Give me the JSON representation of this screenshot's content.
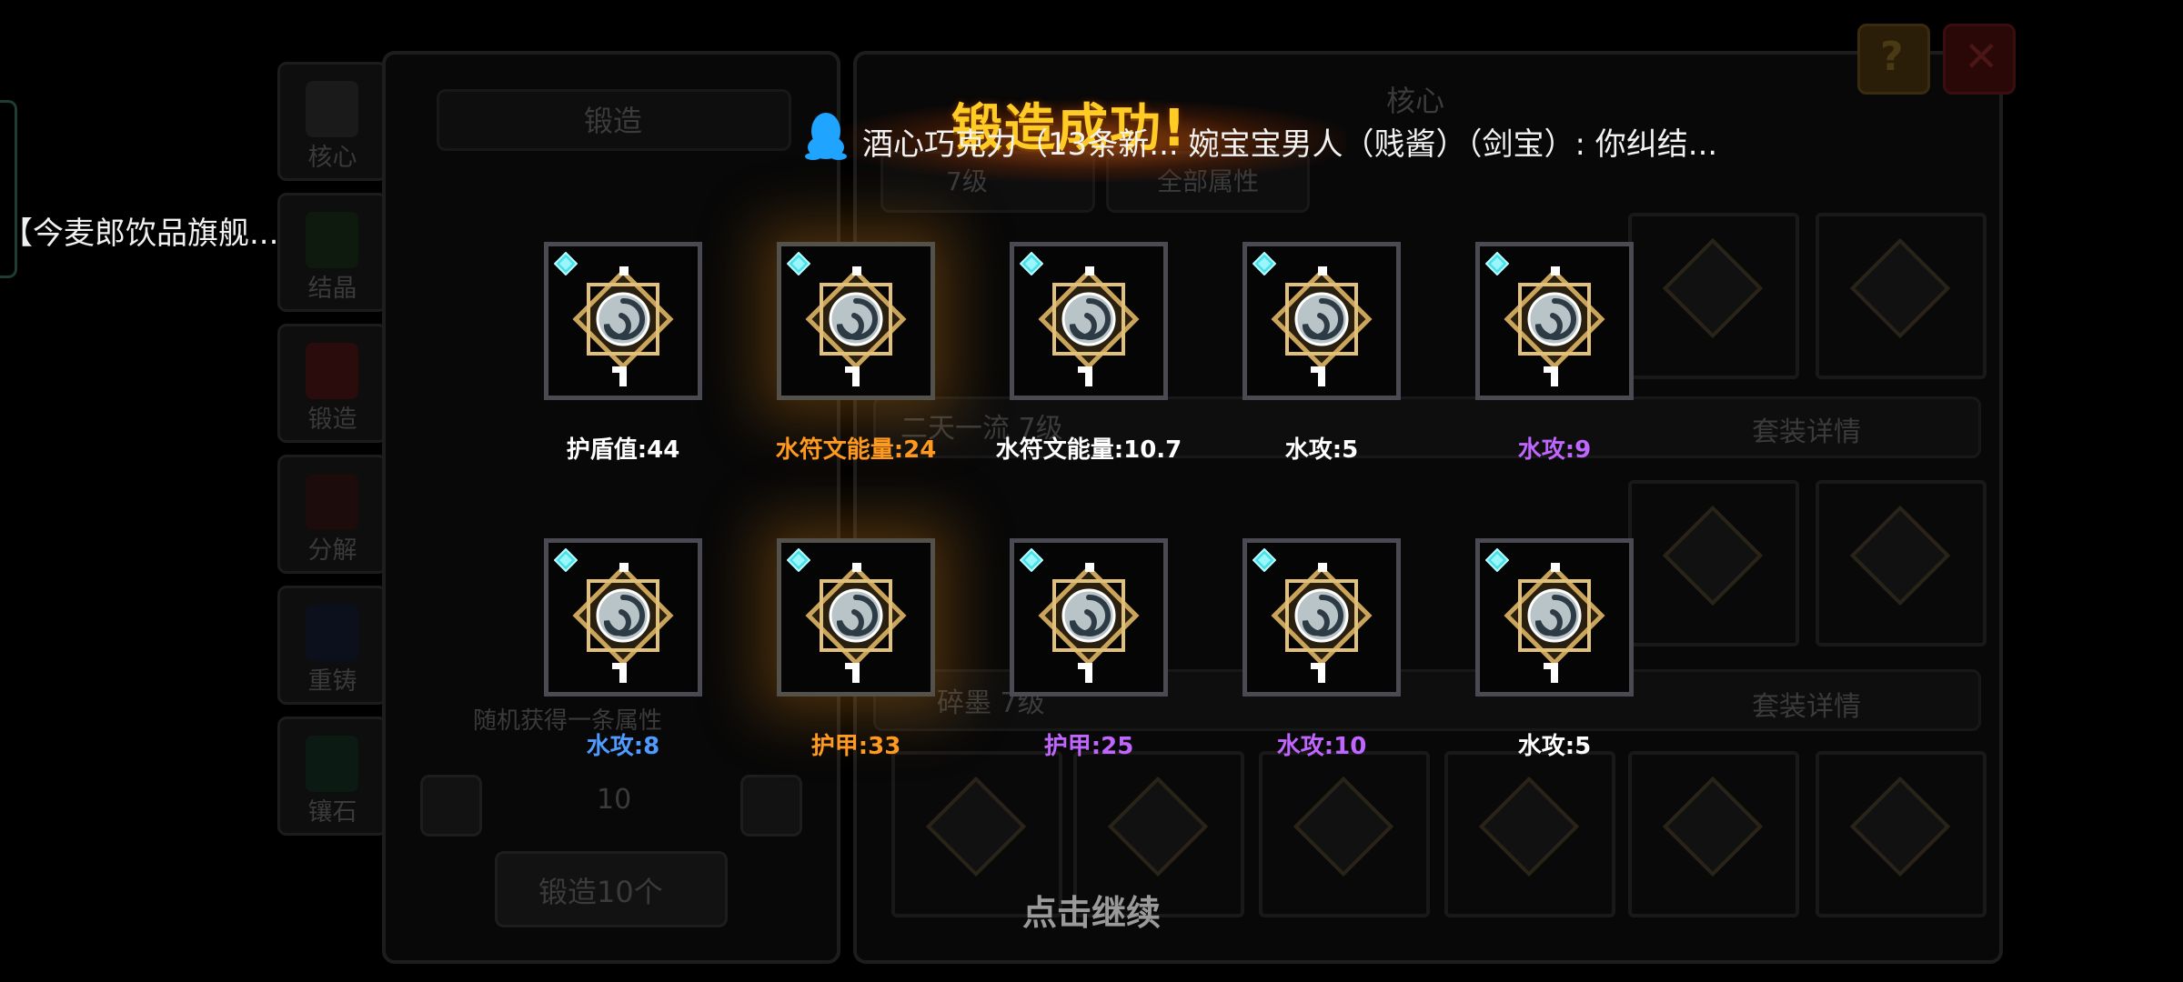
{
  "background": {
    "side_tabs": [
      "核心",
      "结晶",
      "锻造",
      "分解",
      "重铸",
      "镶石"
    ],
    "forge_panel": {
      "header": "锻造",
      "option_text": "随机获得一条属性",
      "quantity": "10",
      "forge_button": "锻造10个"
    },
    "core_panel": {
      "header": "核心",
      "level_filter": "7级",
      "attr_filter": "全部属性",
      "set1_name": "二天一流 7级",
      "set2_name": "碎墨 7级",
      "set_detail_label": "套装详情"
    },
    "help_icon": "question-icon",
    "close_icon": "close-icon"
  },
  "left_notice": {
    "text": "【今麦郎饮品旗舰..."
  },
  "qq_banner": {
    "icon": "qq-penguin-icon",
    "text": "酒心巧克力（13条新...  婉宝宝男人（贱酱）（剑宝）: 你纠结..."
  },
  "result": {
    "title": "锻造成功!",
    "continue_hint": "点击继续",
    "items": [
      {
        "label": "护盾值:44",
        "color": "#ffffff",
        "glow": false
      },
      {
        "label": "水符文能量:24",
        "color": "#ff9a1f",
        "glow": true
      },
      {
        "label": "水符文能量:10.7",
        "color": "#ffffff",
        "glow": false
      },
      {
        "label": "水攻:5",
        "color": "#ffffff",
        "glow": false
      },
      {
        "label": "水攻:9",
        "color": "#c066ff",
        "glow": false
      },
      {
        "label": "水攻:8",
        "color": "#4f9bff",
        "glow": false
      },
      {
        "label": "护甲:33",
        "color": "#ff9a1f",
        "glow": true
      },
      {
        "label": "护甲:25",
        "color": "#c066ff",
        "glow": false
      },
      {
        "label": "水攻:10",
        "color": "#c066ff",
        "glow": false
      },
      {
        "label": "水攻:5",
        "color": "#ffffff",
        "glow": false
      }
    ]
  }
}
